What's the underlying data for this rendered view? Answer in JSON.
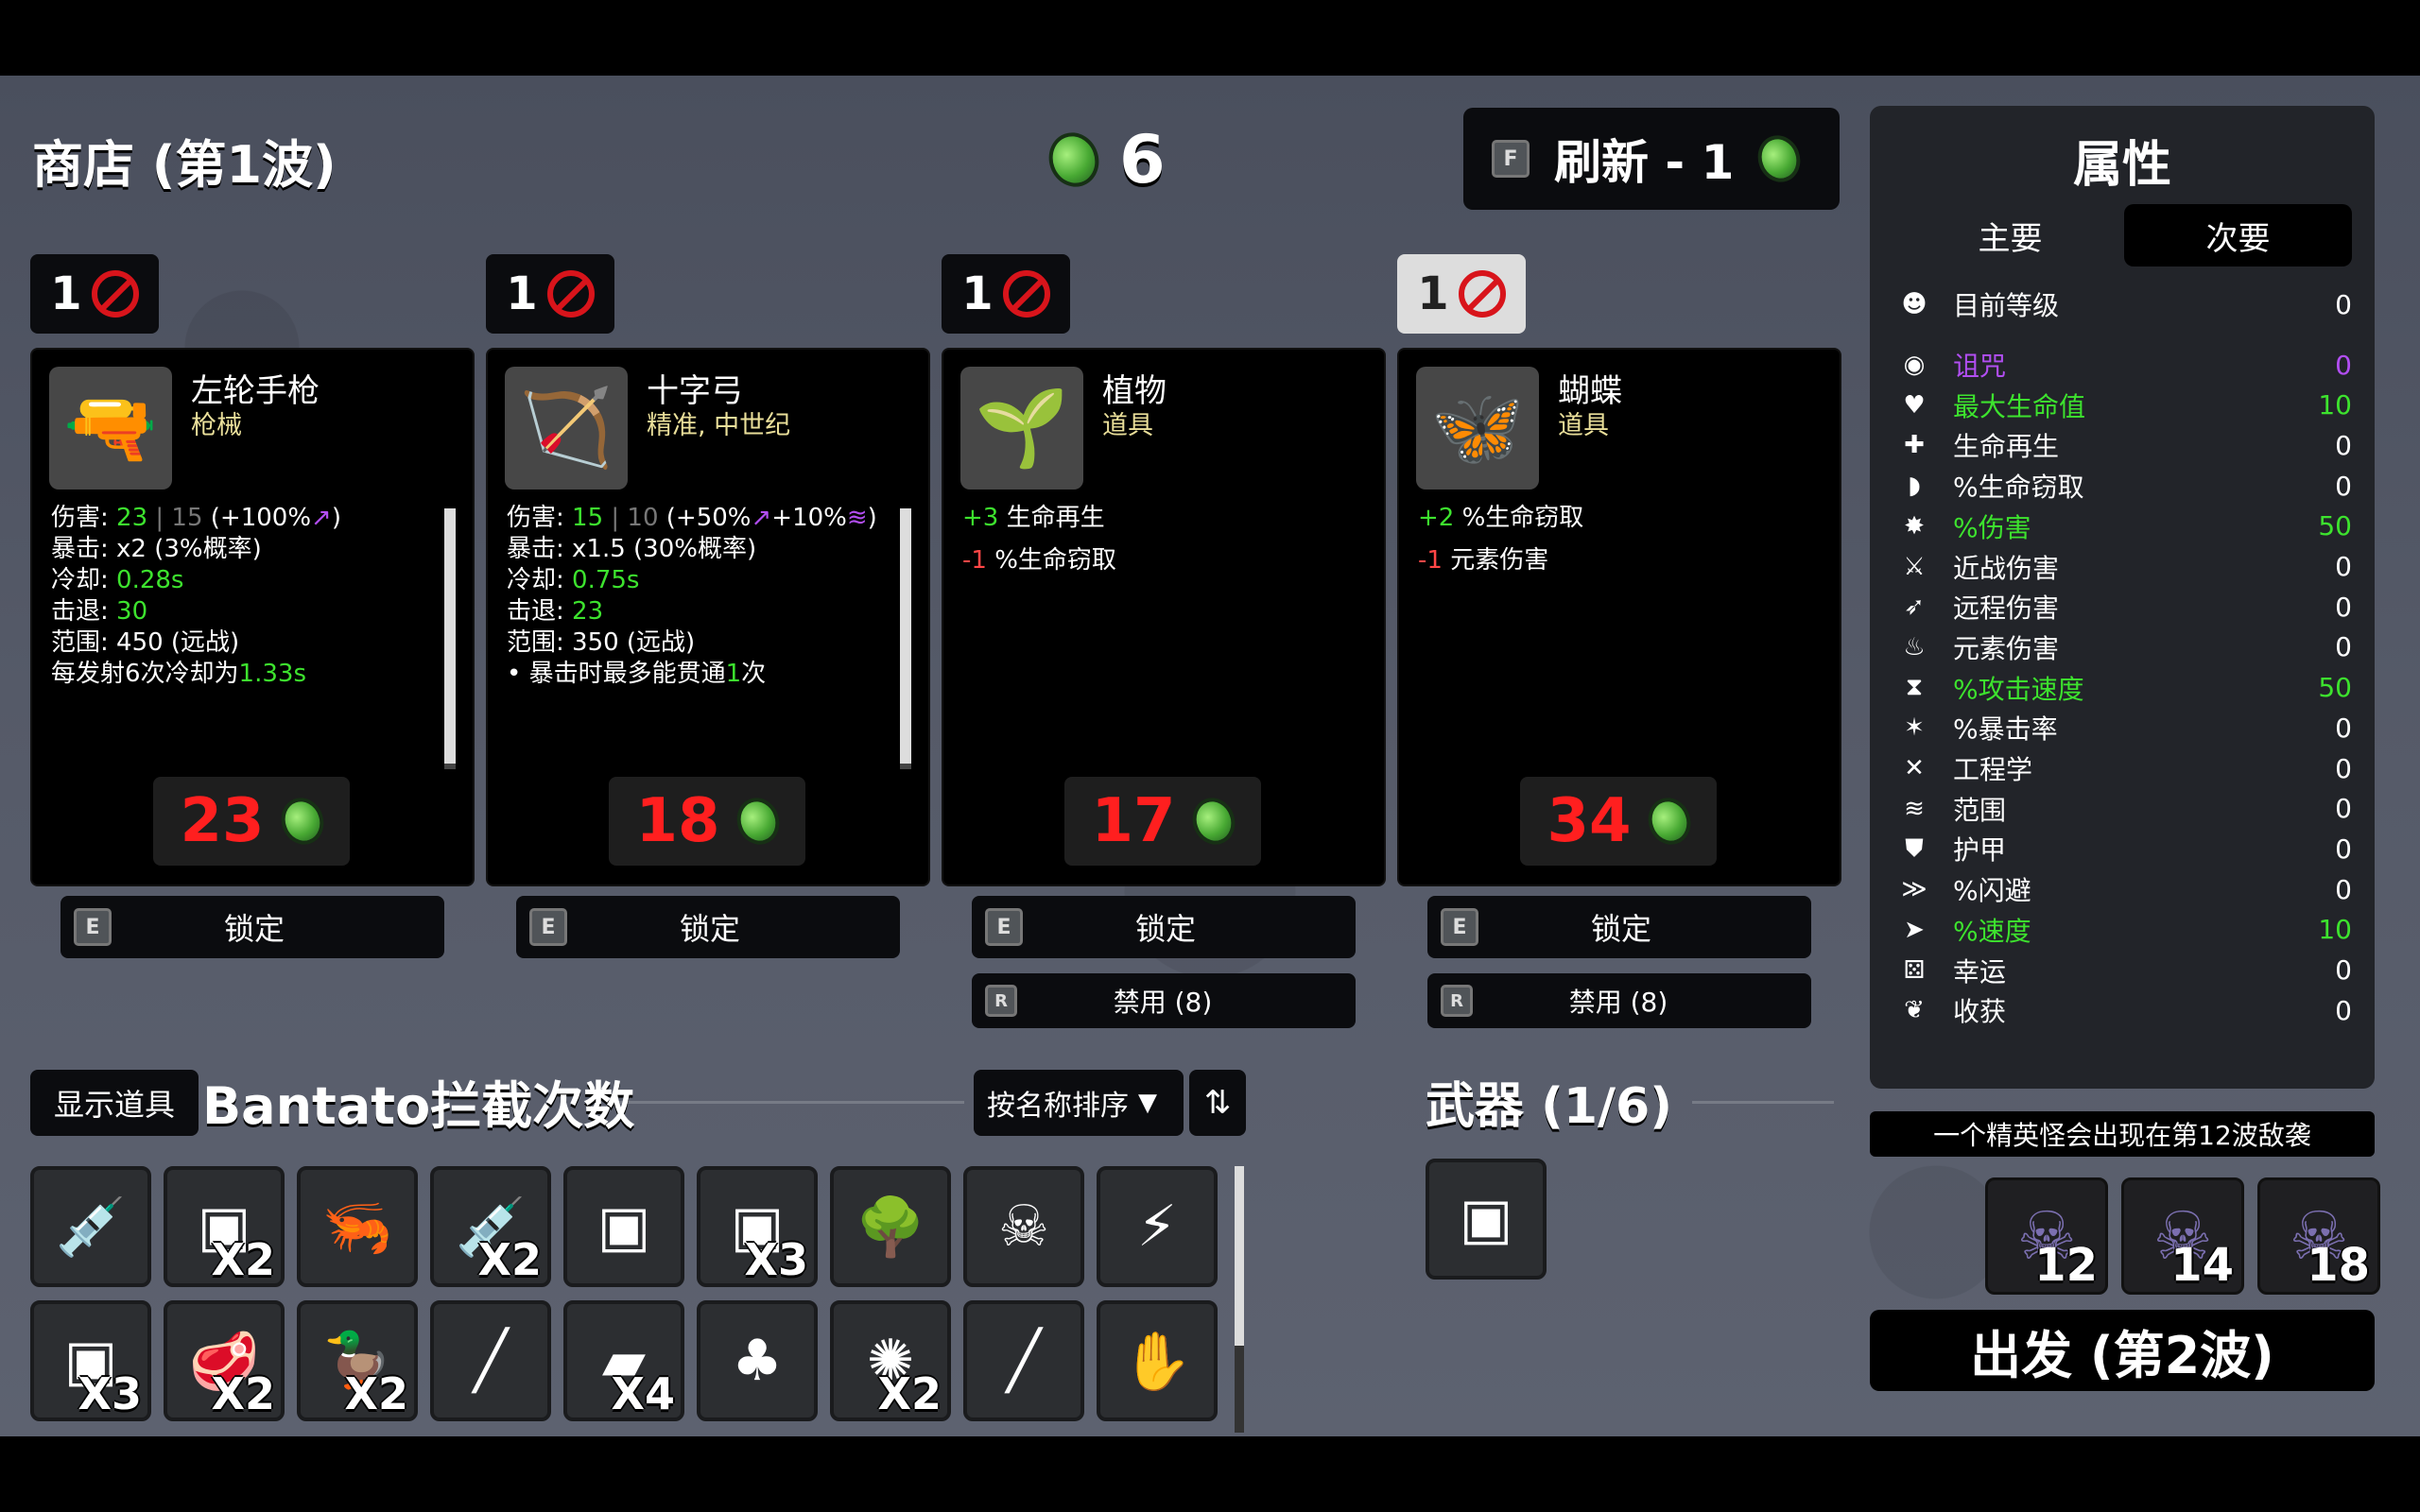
{
  "shop": {
    "title": "商店 (第1波)"
  },
  "materials": {
    "count": "6"
  },
  "refresh": {
    "key": "F",
    "label": "刷新 - 1"
  },
  "items": [
    {
      "qty": "1",
      "name": "左轮手枪",
      "class": "枪械",
      "price": "23",
      "lock_key": "E",
      "lock_label": "锁定",
      "lines": [
        [
          {
            "t": "伤害: "
          },
          {
            "t": "23",
            "c": "g"
          },
          {
            "t": " | ",
            "c": "gray"
          },
          {
            "t": "15",
            "c": "gray"
          },
          {
            "t": " (+100%"
          },
          {
            "t": "↗",
            "c": "purple"
          },
          {
            "t": ")"
          }
        ],
        [
          {
            "t": "暴击: x2 (3%概率)"
          }
        ],
        [
          {
            "t": "冷却: "
          },
          {
            "t": "0.28s",
            "c": "g"
          }
        ],
        [
          {
            "t": "击退: "
          },
          {
            "t": "30",
            "c": "g"
          }
        ],
        [
          {
            "t": "范围: 450 (远战)"
          }
        ],
        [
          {
            "t": "每发射6次冷却为"
          },
          {
            "t": "1.33s",
            "c": "g"
          }
        ]
      ]
    },
    {
      "qty": "1",
      "name": "十字弓",
      "class": "精准, 中世纪",
      "price": "18",
      "lock_key": "E",
      "lock_label": "锁定",
      "lines": [
        [
          {
            "t": "伤害: "
          },
          {
            "t": "15",
            "c": "g"
          },
          {
            "t": " | ",
            "c": "gray"
          },
          {
            "t": "10",
            "c": "gray"
          },
          {
            "t": " (+50%"
          },
          {
            "t": "↗",
            "c": "purple"
          },
          {
            "t": "+10%"
          },
          {
            "t": "≋",
            "c": "purple"
          },
          {
            "t": ")"
          }
        ],
        [
          {
            "t": "暴击: x1.5 (30%概率)"
          }
        ],
        [
          {
            "t": "冷却: "
          },
          {
            "t": "0.75s",
            "c": "g"
          }
        ],
        [
          {
            "t": "击退: "
          },
          {
            "t": "23",
            "c": "g"
          }
        ],
        [
          {
            "t": "范围: 350 (远战)"
          }
        ],
        [
          {
            "t": " • 暴击时最多能贯通"
          },
          {
            "t": "1",
            "c": "g"
          },
          {
            "t": "次"
          }
        ]
      ]
    },
    {
      "qty": "1",
      "name": "植物",
      "class": "道具",
      "price": "17",
      "lock_key": "E",
      "lock_label": "锁定",
      "ban_key": "R",
      "ban_label": "禁用 (8)",
      "lines": [
        [
          {
            "t": "+3",
            "c": "g"
          },
          {
            "t": " 生命再生"
          }
        ],
        [
          {
            "t": "-1",
            "c": "r"
          },
          {
            "t": " %生命窃取"
          }
        ]
      ]
    },
    {
      "qty": "1",
      "name": "蝴蝶",
      "class": "道具",
      "price": "34",
      "lock_key": "E",
      "lock_label": "锁定",
      "ban_key": "R",
      "ban_label": "禁用 (8)",
      "lines": [
        [
          {
            "t": "+2",
            "c": "g"
          },
          {
            "t": " %生命窃取"
          }
        ],
        [
          {
            "t": "-1",
            "c": "r"
          },
          {
            "t": " 元素伤害"
          }
        ]
      ]
    }
  ],
  "stats_panel": {
    "title": "属性",
    "tab_main": "主要",
    "tab_secondary": "次要",
    "rows": [
      {
        "icon": "level-icon",
        "glyph": "☻",
        "label": "目前等级",
        "value": "0",
        "color": "#ffffff"
      },
      {
        "icon": "curse-icon",
        "glyph": "◉",
        "label": "诅咒",
        "value": "0",
        "color": "#b24ef2"
      },
      {
        "icon": "heart-icon",
        "glyph": "♥",
        "label": "最大生命值",
        "value": "10",
        "color": "#3de32e"
      },
      {
        "icon": "regen-icon",
        "glyph": "✚",
        "label": "生命再生",
        "value": "0",
        "color": "#ffffff"
      },
      {
        "icon": "lifesteal-icon",
        "glyph": "◗",
        "label": "%生命窃取",
        "value": "0",
        "color": "#ffffff"
      },
      {
        "icon": "damage-icon",
        "glyph": "✸",
        "label": "%伤害",
        "value": "50",
        "color": "#3de32e"
      },
      {
        "icon": "melee-icon",
        "glyph": "⚔",
        "label": "近战伤害",
        "value": "0",
        "color": "#ffffff"
      },
      {
        "icon": "ranged-icon",
        "glyph": "➶",
        "label": "远程伤害",
        "value": "0",
        "color": "#ffffff"
      },
      {
        "icon": "elemental-icon",
        "glyph": "♨",
        "label": "元素伤害",
        "value": "0",
        "color": "#ffffff"
      },
      {
        "icon": "attack-speed-icon",
        "glyph": "⧗",
        "label": "%攻击速度",
        "value": "50",
        "color": "#3de32e"
      },
      {
        "icon": "crit-icon",
        "glyph": "✶",
        "label": "%暴击率",
        "value": "0",
        "color": "#ffffff"
      },
      {
        "icon": "engineering-icon",
        "glyph": "✕",
        "label": "工程学",
        "value": "0",
        "color": "#ffffff"
      },
      {
        "icon": "range-icon",
        "glyph": "≋",
        "label": "范围",
        "value": "0",
        "color": "#ffffff"
      },
      {
        "icon": "armor-icon",
        "glyph": "⛊",
        "label": "护甲",
        "value": "0",
        "color": "#ffffff"
      },
      {
        "icon": "dodge-icon",
        "glyph": "≫",
        "label": "%闪避",
        "value": "0",
        "color": "#ffffff"
      },
      {
        "icon": "speed-icon",
        "glyph": "➤",
        "label": "%速度",
        "value": "10",
        "color": "#3de32e"
      },
      {
        "icon": "luck-icon",
        "glyph": "⚄",
        "label": "幸运",
        "value": "0",
        "color": "#ffffff"
      },
      {
        "icon": "harvest-icon",
        "glyph": "❦",
        "label": "收获",
        "value": "0",
        "color": "#ffffff"
      }
    ]
  },
  "elite_notice": "一个精英怪会出现在第12波敌袭",
  "bosses": [
    "12",
    "14",
    "18"
  ],
  "go_button": "出发 (第2波)",
  "inventory": {
    "show_items_label": "显示道具",
    "title": "Bantato拦截次数",
    "sort_label": "按名称排序",
    "items": [
      {
        "icon": "syringe-icon",
        "glyph": "💉",
        "count": ""
      },
      {
        "icon": "turret-icon",
        "glyph": "▣",
        "count": "X2"
      },
      {
        "icon": "shrimp-icon",
        "glyph": "🦐",
        "count": ""
      },
      {
        "icon": "medical-syringe-icon",
        "glyph": "💉",
        "count": "X2"
      },
      {
        "icon": "gray-turret-icon",
        "glyph": "▣",
        "count": ""
      },
      {
        "icon": "white-turret-icon",
        "glyph": "▣",
        "count": "X3"
      },
      {
        "icon": "tree-icon",
        "glyph": "🌳",
        "count": ""
      },
      {
        "icon": "skull-icon",
        "glyph": "☠",
        "count": ""
      },
      {
        "icon": "taser-icon",
        "glyph": "⚡",
        "count": ""
      },
      {
        "icon": "gun-icon",
        "glyph": "▣",
        "count": "X3"
      },
      {
        "icon": "steak-icon",
        "glyph": "🥩",
        "count": "X2"
      },
      {
        "icon": "duck-icon",
        "glyph": "🦆",
        "count": "X2"
      },
      {
        "icon": "needle-icon",
        "glyph": "╱",
        "count": ""
      },
      {
        "icon": "shotgun-icon",
        "glyph": "▰",
        "count": "X4"
      },
      {
        "icon": "sack-icon",
        "glyph": "♣",
        "count": ""
      },
      {
        "icon": "hedgehog-icon",
        "glyph": "✺",
        "count": "X2"
      },
      {
        "icon": "knife-icon",
        "glyph": "╱",
        "count": ""
      },
      {
        "icon": "hand-icon",
        "glyph": "✋",
        "count": ""
      }
    ]
  },
  "weapons": {
    "title": "武器 (1/6)",
    "items": [
      {
        "icon": "pistol-weapon-icon",
        "glyph": "▣"
      }
    ]
  }
}
